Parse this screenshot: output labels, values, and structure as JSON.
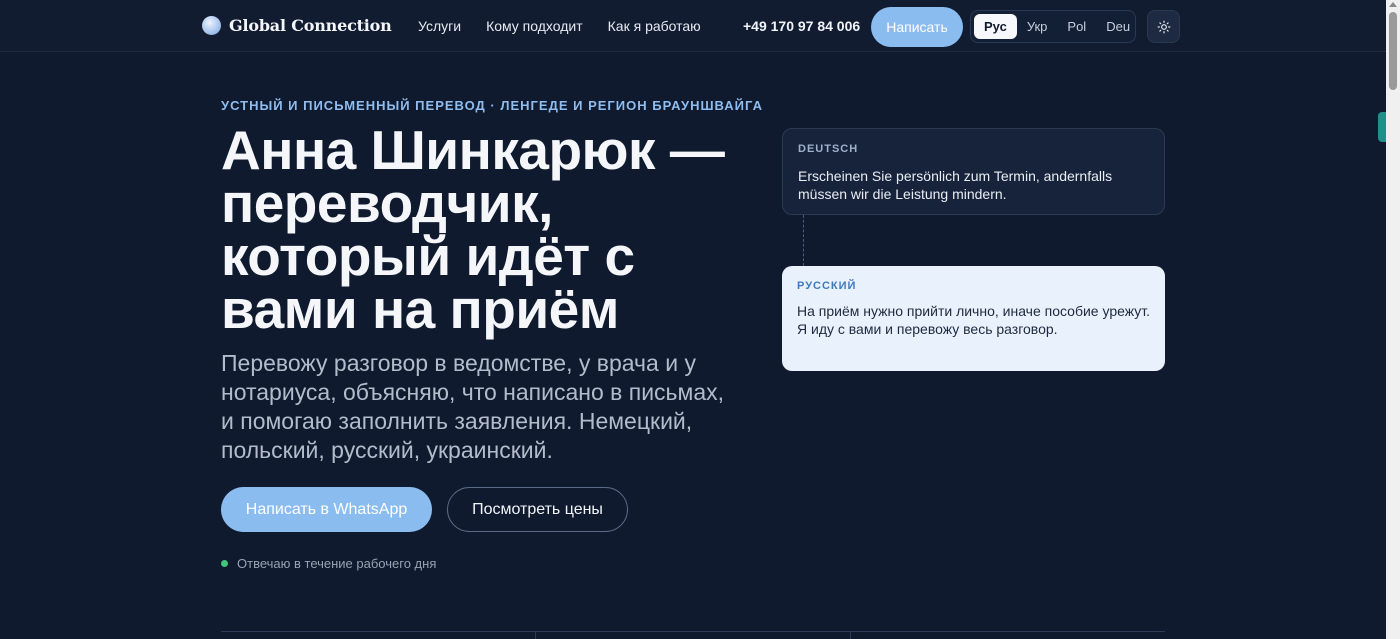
{
  "header": {
    "logo_text": "Global Connection",
    "nav": [
      "Услуги",
      "Кому подходит",
      "Как я работаю"
    ],
    "phone": "+49 170 97 84 006",
    "write_label": "Написать",
    "languages": [
      "Рус",
      "Укр",
      "Pol",
      "Deu"
    ],
    "active_language": "Рус",
    "theme_icon": "sun-icon"
  },
  "hero": {
    "eyebrow": "УСТНЫЙ И ПИСЬМЕННЫЙ ПЕРЕВОД · ЛЕНГЕДЕ И РЕГИОН БРАУНШВАЙГА",
    "title": "Анна Шинкарюк — переводчик, который идёт с вами на приём",
    "lead": "Перевожу разговор в ведомстве, у врача и у нотариуса, объясняю, что написано в письмах, и помогаю заполнить заявления. Немецкий, польский, русский, украинский.",
    "cta_primary": "Написать в WhatsApp",
    "cta_secondary": "Посмотреть цены",
    "reply_note": "Отвечаю в течение рабочего дня"
  },
  "cards": {
    "de": {
      "label": "DEUTSCH",
      "text": "Erscheinen Sie persönlich zum Termin, andernfalls müssen wir die Leistung mindern."
    },
    "ru": {
      "label": "РУССКИЙ",
      "text": "На приём нужно прийти лично, иначе пособие урежут. Я иду с вами и перевожу весь разговор."
    }
  },
  "colors": {
    "background": "#0f1a2e",
    "accent": "#8bbcf0",
    "status_green": "#3fc77a"
  }
}
